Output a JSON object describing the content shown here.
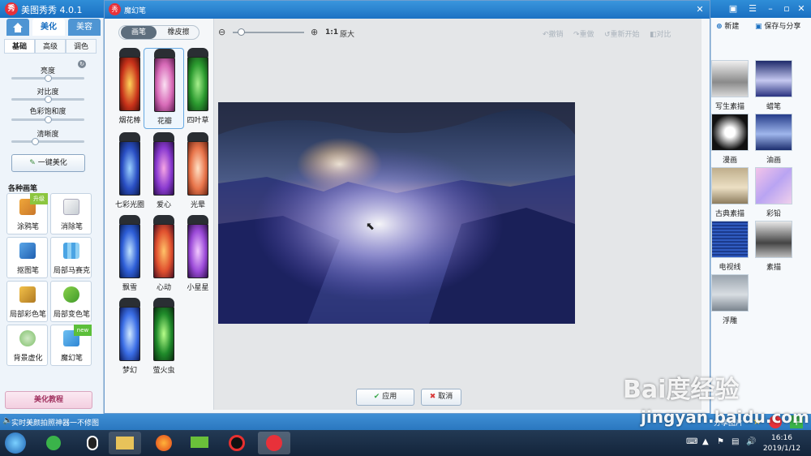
{
  "app": {
    "title": "美图秀秀 4.0.1",
    "logo_text": "秀"
  },
  "left_panel": {
    "top_tabs": [
      "美化",
      "美容"
    ],
    "sub_tabs": [
      "基础",
      "高级",
      "调色"
    ],
    "sliders": [
      {
        "label": "亮度",
        "value": 0.5
      },
      {
        "label": "对比度",
        "value": 0.5
      },
      {
        "label": "色彩饱和度",
        "value": 0.5
      },
      {
        "label": "清晰度",
        "value": 0.3
      }
    ],
    "one_click": "一键美化",
    "section_title": "各种画笔",
    "tools": [
      {
        "label": "涂鸦笔",
        "badge": "升级"
      },
      {
        "label": "消除笔"
      },
      {
        "label": "抠图笔"
      },
      {
        "label": "局部马赛克"
      },
      {
        "label": "局部彩色笔"
      },
      {
        "label": "局部变色笔"
      },
      {
        "label": "背景虚化"
      },
      {
        "label": "魔幻笔",
        "badge": "new"
      }
    ],
    "tutorial": "美化教程"
  },
  "dialog": {
    "title": "魔幻笔",
    "mode_tabs": [
      "画笔",
      "橡皮擦"
    ],
    "pens": [
      {
        "label": "烟花棒",
        "color": "#d2451e"
      },
      {
        "label": "花瓣",
        "color": "#d86bb8"
      },
      {
        "label": "四叶草",
        "color": "#2b9a2f"
      },
      {
        "label": "七彩光圈",
        "color": "#2a4fc4"
      },
      {
        "label": "爱心",
        "color": "#8a3ad0"
      },
      {
        "label": "光晕",
        "color": "#e8744a"
      },
      {
        "label": "飘雪",
        "color": "#2f5fd8"
      },
      {
        "label": "心动",
        "color": "#e0502e"
      },
      {
        "label": "小星星",
        "color": "#9b4ad8"
      },
      {
        "label": "梦幻",
        "color": "#3b6ee6"
      },
      {
        "label": "萤火虫",
        "color": "#1f8a2a"
      }
    ],
    "selected_pen": 1,
    "toolbar": {
      "zoom_ratio": "1:1",
      "original": "原大",
      "undo": "撤销",
      "redo": "重做",
      "restart": "重新开始",
      "compare": "对比"
    },
    "apply": "应用",
    "cancel": "取消"
  },
  "right_panel": {
    "new_btn": "新建",
    "save_btn": "保存与分享",
    "effects": [
      "写生素描",
      "蜡笔",
      "漫画",
      "油画",
      "古典素描",
      "彩铅",
      "电视线",
      "素描",
      "浮雕"
    ],
    "share": "分享图片"
  },
  "status": {
    "text": "实时美颜拍照神器一不修图"
  },
  "clock": {
    "time": "16:16",
    "date": "2019/1/12"
  },
  "watermark": {
    "brand": "Bai度经验",
    "url": "jingyan.baidu.com"
  }
}
